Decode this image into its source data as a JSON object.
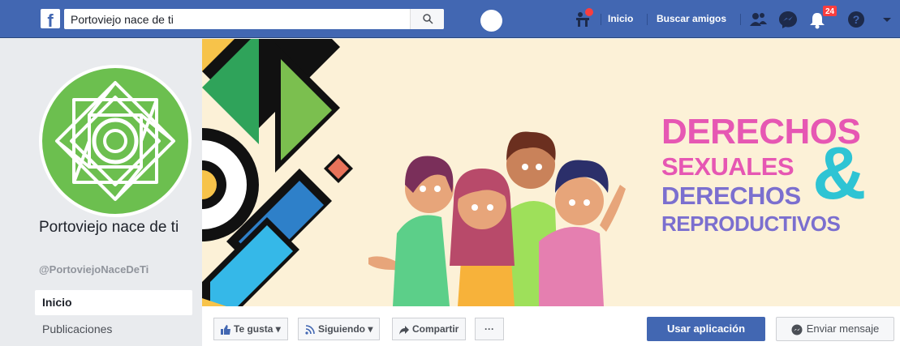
{
  "header": {
    "logo_letter": "f",
    "search_value": "Portoviejo nace de ti",
    "nav_home": "Inicio",
    "nav_find_friends": "Buscar amigos",
    "notification_count": "24",
    "brand_color": "#4267b2"
  },
  "sidebar": {
    "page_name": "Portoviejo nace de ti",
    "page_handle": "@PortoviejoNaceDeTi",
    "items": [
      {
        "label": "Inicio",
        "active": true
      },
      {
        "label": "Publicaciones",
        "active": false
      }
    ]
  },
  "cover": {
    "line1": "DERECHOS",
    "line2": "SEXUALES",
    "line3": "DERECHOS",
    "line4": "REPRODUCTIVOS",
    "ampersand": "&",
    "colors": {
      "pink": "#e657b3",
      "purple": "#7b6fcf",
      "teal": "#2ec4d4",
      "background": "#fcf1d7"
    }
  },
  "actions": {
    "like": "Te gusta",
    "following": "Siguiendo",
    "share": "Compartir",
    "more": "···",
    "use_app": "Usar aplicación",
    "send_message": "Enviar mensaje"
  }
}
